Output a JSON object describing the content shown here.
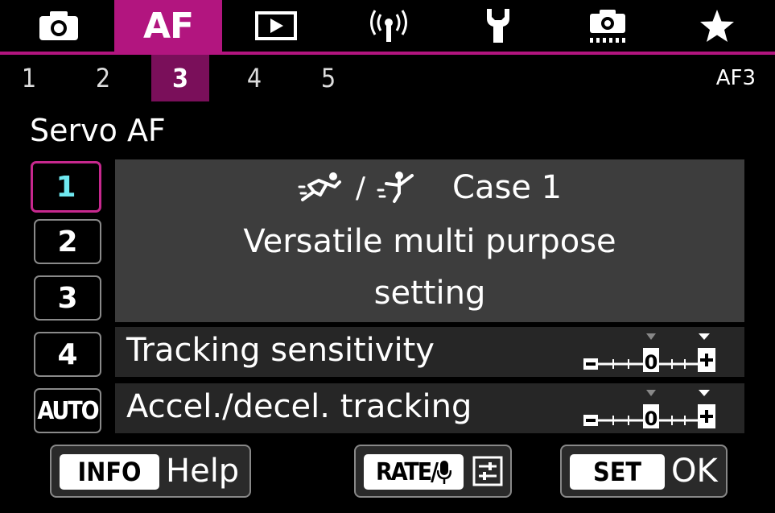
{
  "menu_tabs": [
    {
      "name": "shooting",
      "icon": "camera-icon"
    },
    {
      "name": "af",
      "label": "AF",
      "active": true
    },
    {
      "name": "playback",
      "icon": "playback-icon"
    },
    {
      "name": "wireless",
      "icon": "wireless-icon"
    },
    {
      "name": "setup",
      "icon": "wrench-icon"
    },
    {
      "name": "custom",
      "icon": "custom-camera-icon"
    },
    {
      "name": "my-menu",
      "icon": "star-icon"
    }
  ],
  "sub_tabs": [
    "1",
    "2",
    "3",
    "4",
    "5"
  ],
  "active_sub_tab": "3",
  "page_code": "AF3",
  "section_title": "Servo AF",
  "cases": [
    "1",
    "2",
    "3",
    "4",
    "AUTO"
  ],
  "selected_case": "1",
  "description": {
    "separator": "/",
    "case_name": "Case 1",
    "text": "Versatile multi purpose setting"
  },
  "parameters": [
    {
      "label": "Tracking sensitivity",
      "scale_center": "0",
      "current_value": 0,
      "default_value": 0
    },
    {
      "label": "Accel./decel. tracking",
      "scale_center": "0",
      "current_value": 0,
      "default_value": 0
    }
  ],
  "bottom_buttons": {
    "info": {
      "key": "INFO",
      "label": "Help"
    },
    "rate": {
      "key": "RATE/"
    },
    "set": {
      "key": "SET",
      "label": "OK"
    }
  },
  "colors": {
    "accent": "#b2157f",
    "selected_text": "#6fe8f0",
    "panel": "#3d3d3d"
  }
}
